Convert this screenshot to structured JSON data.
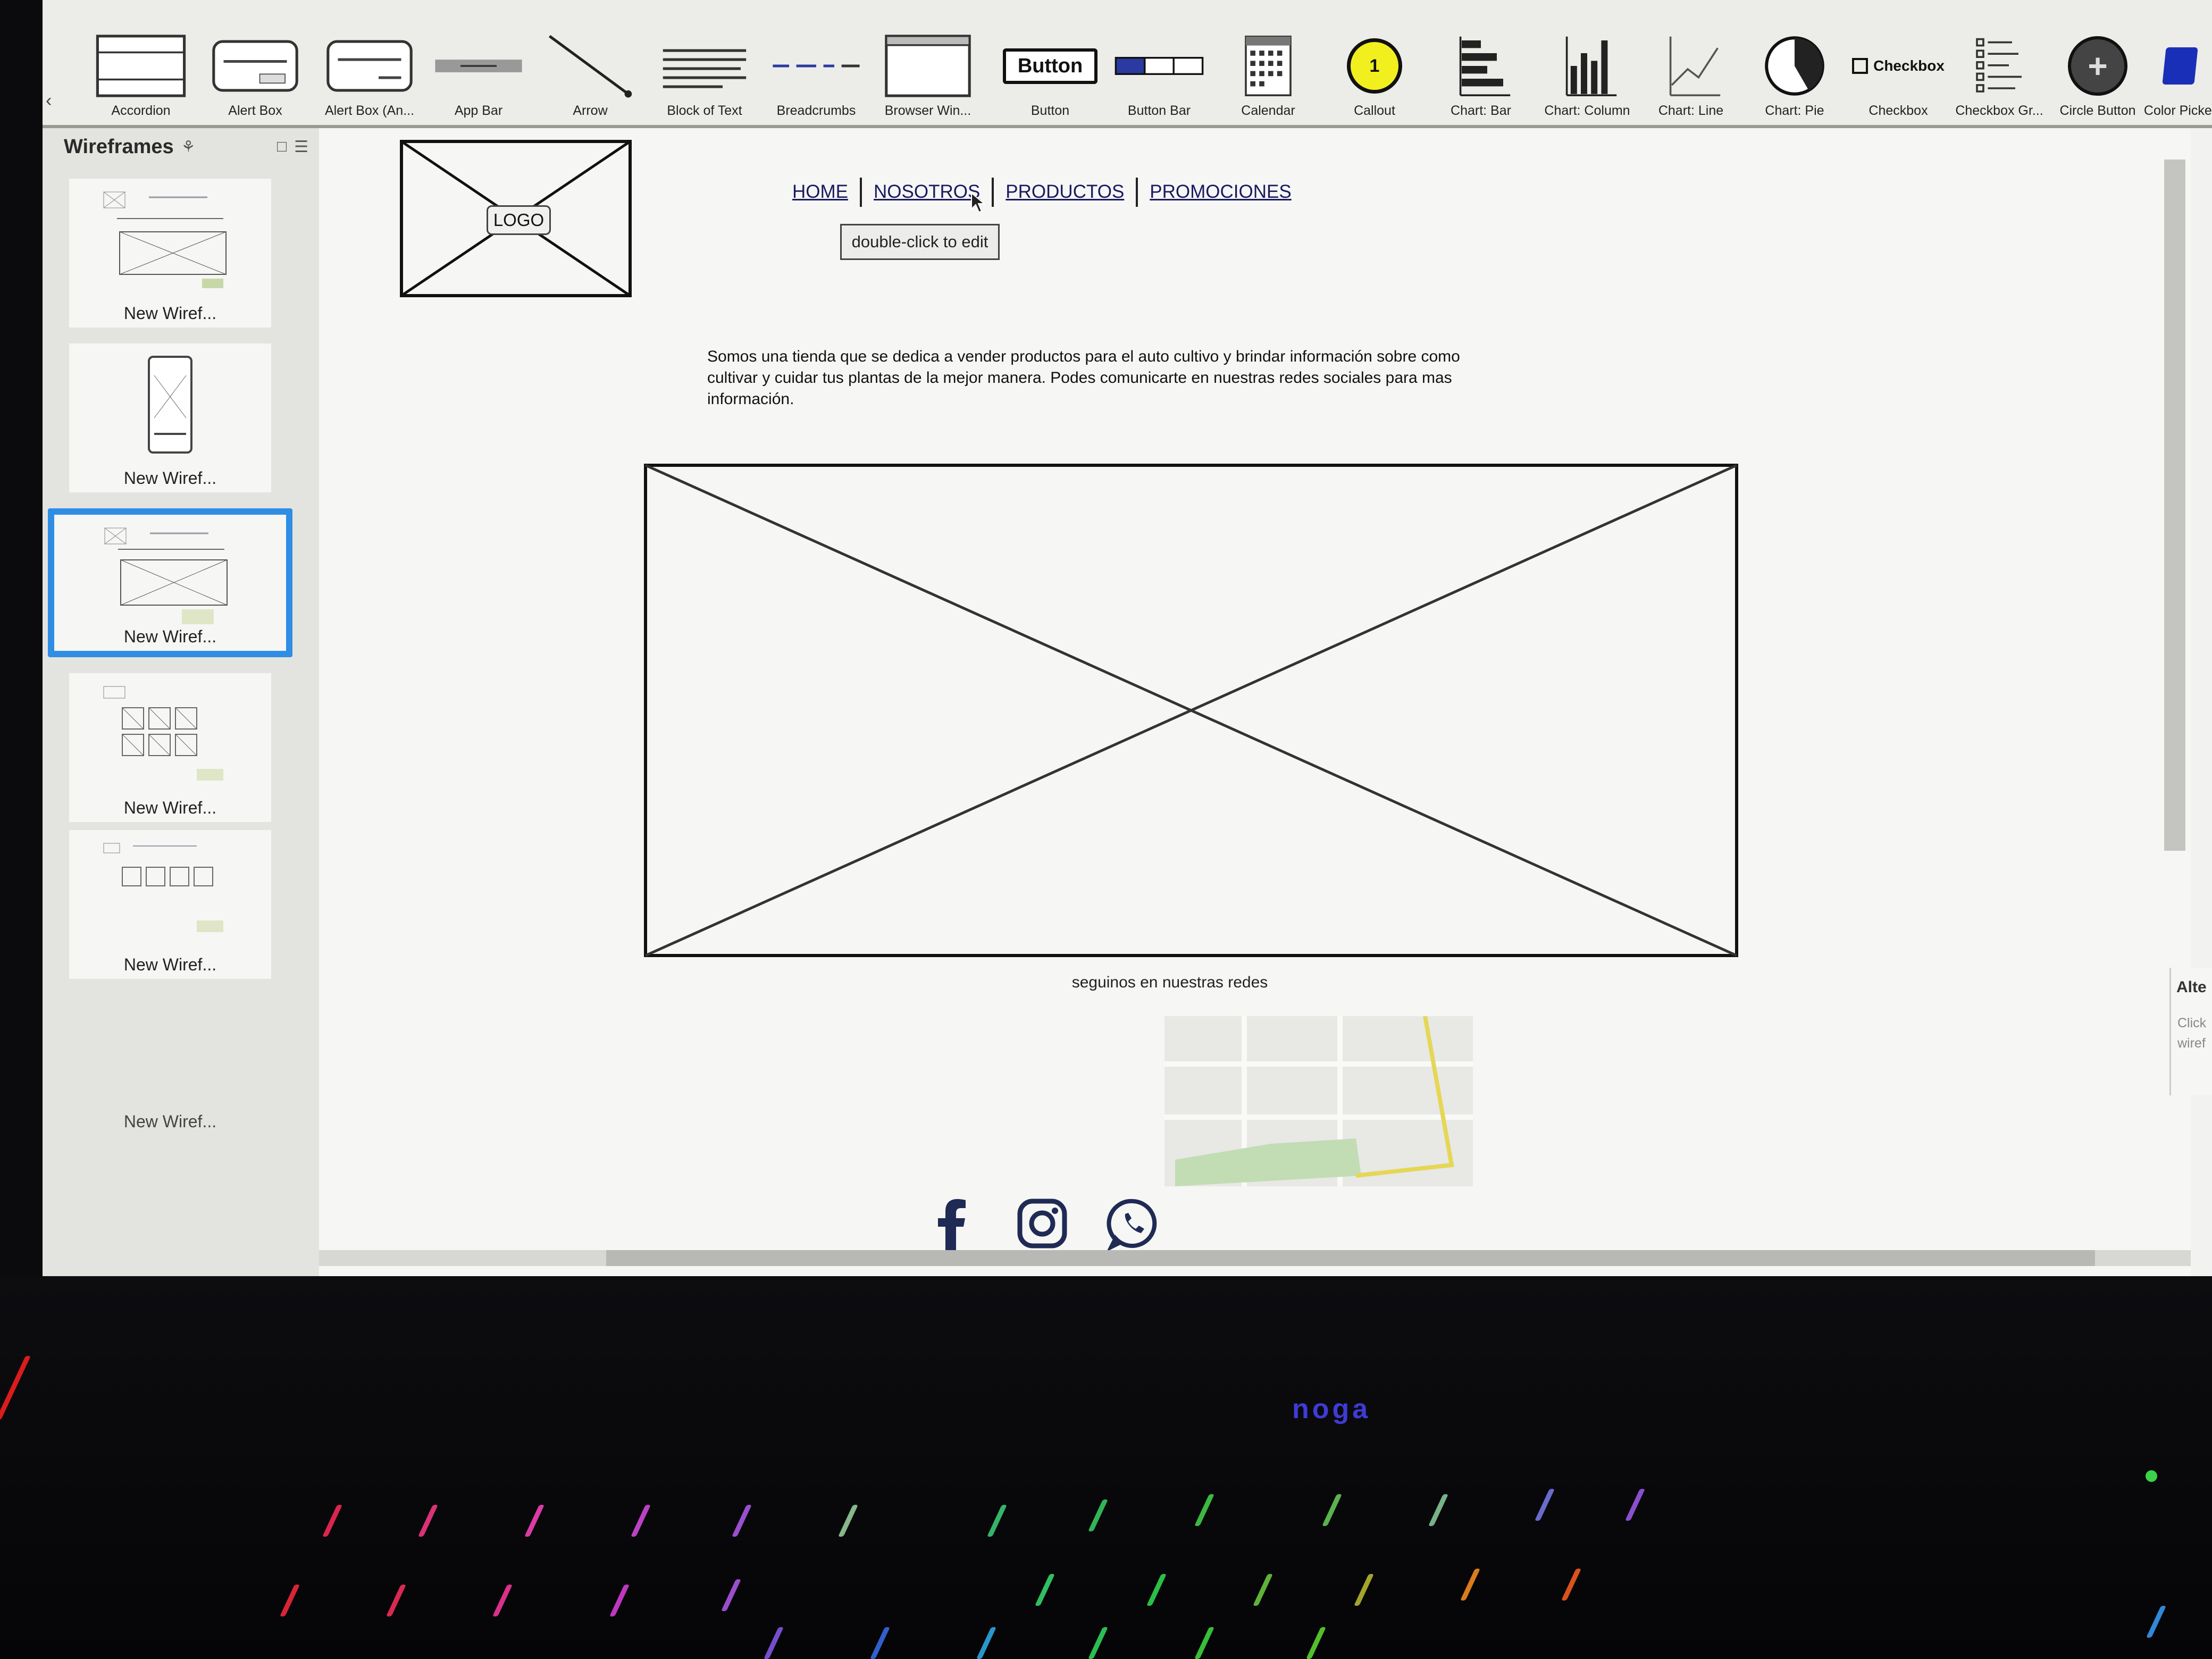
{
  "library": {
    "items": [
      {
        "label": "Accordion",
        "icon": "accordion-icon"
      },
      {
        "label": "Alert Box",
        "icon": "alert-box-icon"
      },
      {
        "label": "Alert Box (An...",
        "icon": "alert-box-icon"
      },
      {
        "label": "App Bar",
        "icon": "app-bar-icon"
      },
      {
        "label": "Arrow",
        "icon": "arrow-icon"
      },
      {
        "label": "Block of Text",
        "icon": "text-block-icon"
      },
      {
        "label": "Breadcrumbs",
        "icon": "breadcrumbs-icon"
      },
      {
        "label": "Browser Win...",
        "icon": "browser-window-icon"
      },
      {
        "label": "Button",
        "icon": "button-icon",
        "preview": "Button"
      },
      {
        "label": "Button Bar",
        "icon": "button-bar-icon"
      },
      {
        "label": "Calendar",
        "icon": "calendar-icon"
      },
      {
        "label": "Callout",
        "icon": "callout-icon",
        "preview": "1"
      },
      {
        "label": "Chart: Bar",
        "icon": "bar-chart-icon"
      },
      {
        "label": "Chart: Column",
        "icon": "column-chart-icon"
      },
      {
        "label": "Chart: Line",
        "icon": "line-chart-icon"
      },
      {
        "label": "Chart: Pie",
        "icon": "pie-chart-icon"
      },
      {
        "label": "Checkbox",
        "icon": "checkbox-icon",
        "preview": "Checkbox"
      },
      {
        "label": "Checkbox Gr...",
        "icon": "checkbox-group-icon"
      },
      {
        "label": "Circle Button",
        "icon": "circle-button-icon"
      },
      {
        "label": "Color Picker",
        "icon": "color-picker-icon"
      }
    ]
  },
  "sidebar": {
    "title": "Wireframes",
    "items": [
      {
        "label": "New Wiref...",
        "selected": false
      },
      {
        "label": "New Wiref...",
        "selected": false
      },
      {
        "label": "New Wiref...",
        "selected": true
      },
      {
        "label": "New Wiref...",
        "selected": false
      },
      {
        "label": "New Wiref...",
        "selected": false
      },
      {
        "label": "New Wiref...",
        "selected": false
      }
    ]
  },
  "canvas": {
    "logo": "LOGO",
    "nav": [
      "HOME",
      "NOSOTROS",
      "PRODUCTOS",
      "PROMOCIONES"
    ],
    "edit_button": "double-click to edit",
    "body_text": "Somos una tienda que se dedica a vender productos para el auto cultivo y brindar información sobre como cultivar y cuidar tus plantas de la mejor manera. Podes comunicarte en nuestras redes sociales para mas información.",
    "follow_text": "seguinos en nuestras redes",
    "social_icons": [
      "facebook-icon",
      "instagram-icon",
      "whatsapp-icon"
    ]
  },
  "props_panel": {
    "title": "Alte",
    "hint": "Click wiref"
  },
  "device": {
    "brand": "noga",
    "brand_color": "#3e3bd6"
  }
}
